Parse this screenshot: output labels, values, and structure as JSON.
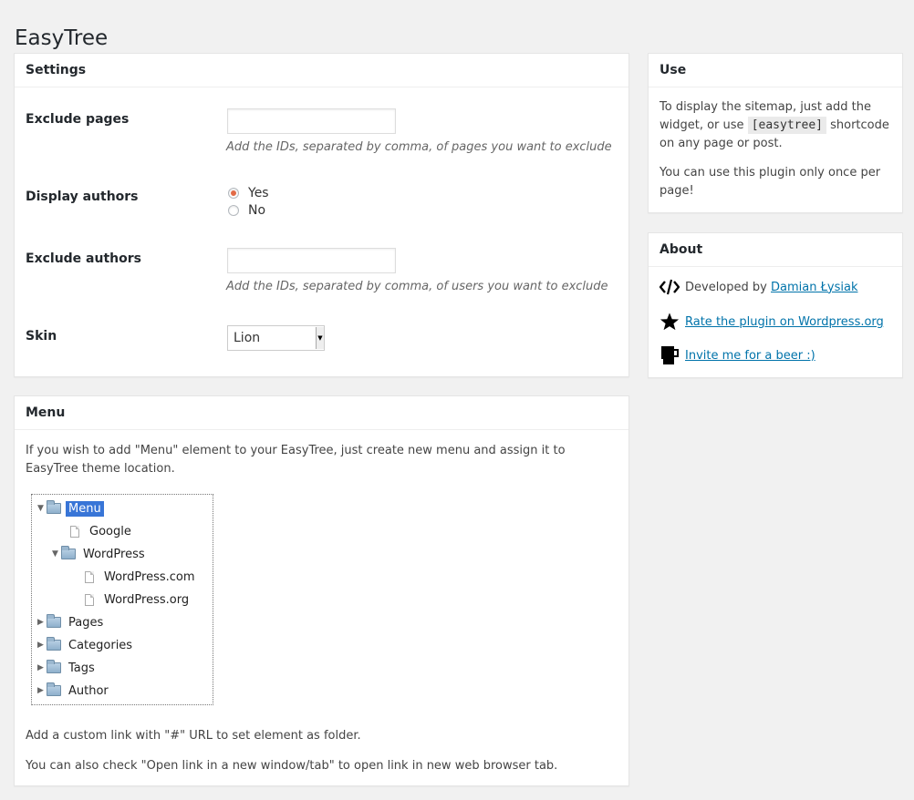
{
  "page": {
    "title": "EasyTree"
  },
  "settings": {
    "title": "Settings",
    "exclude_pages": {
      "label": "Exclude pages",
      "value": "",
      "description": "Add the IDs, separated by comma, of pages you want to exclude"
    },
    "display_authors": {
      "label": "Display authors",
      "options": [
        "Yes",
        "No"
      ],
      "selected": "Yes"
    },
    "exclude_authors": {
      "label": "Exclude authors",
      "value": "",
      "description": "Add the IDs, separated by comma, of users you want to exclude"
    },
    "skin": {
      "label": "Skin",
      "value": "Lion"
    }
  },
  "menu": {
    "title": "Menu",
    "intro": "If you wish to add \"Menu\" element to your EasyTree, just create new menu and assign it to EasyTree theme location.",
    "tree": {
      "root": "Menu",
      "items": [
        "Google",
        "WordPress",
        "WordPress.com",
        "WordPress.org",
        "Pages",
        "Categories",
        "Tags",
        "Author"
      ]
    },
    "note1": "Add a custom link with \"#\" URL to set element as folder.",
    "note2": "You can also check \"Open link in a new window/tab\" to open link in new web browser tab."
  },
  "use": {
    "title": "Use",
    "text_before": "To display the sitemap, just add the widget, or use",
    "shortcode": "[easytree]",
    "text_after": "shortcode on any page or post.",
    "note": "You can use this plugin only once per page!"
  },
  "about": {
    "title": "About",
    "developed_prefix": "Developed by",
    "developer": "Damian Łysiak",
    "rate": "Rate the plugin on Wordpress.org",
    "beer": "Invite me for a beer :)"
  },
  "colors": {
    "accent": "#0073aa",
    "selection": "#3875d7",
    "radio": "#e26b47"
  }
}
